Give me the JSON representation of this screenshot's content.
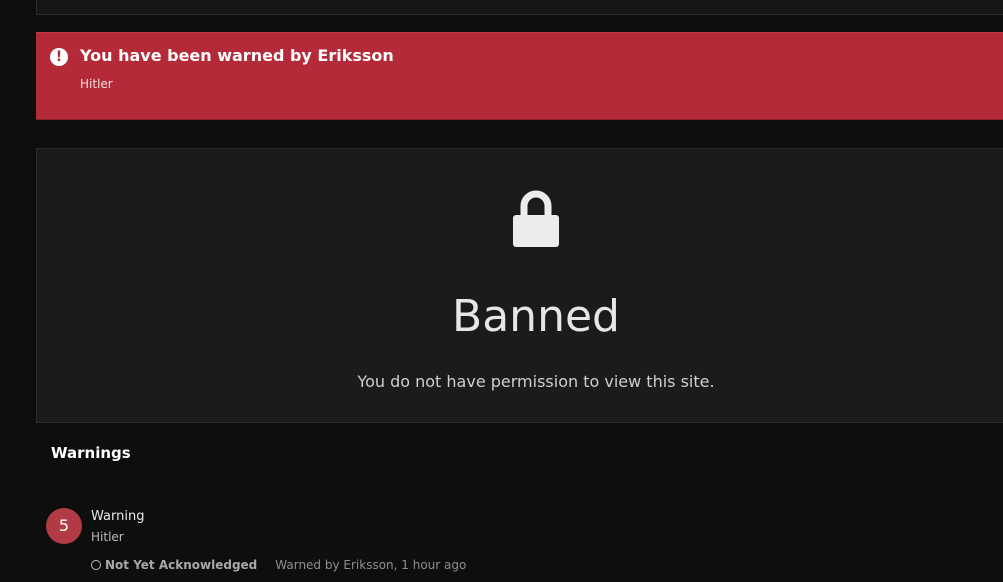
{
  "alert": {
    "icon": "exclamation-circle-icon",
    "title": "You have been warned by Eriksson",
    "reason": "Hitler",
    "color": "#b52a38"
  },
  "ban": {
    "icon": "lock-icon",
    "title": "Banned",
    "message": "You do not have permission to view this site."
  },
  "warnings": {
    "heading": "Warnings",
    "items": [
      {
        "points": "5",
        "title": "Warning",
        "reason": "Hitler",
        "status": "Not Yet Acknowledged",
        "warned_by": "Warned by Eriksson, 1 hour ago",
        "badge_color": "#b23a44"
      }
    ]
  }
}
